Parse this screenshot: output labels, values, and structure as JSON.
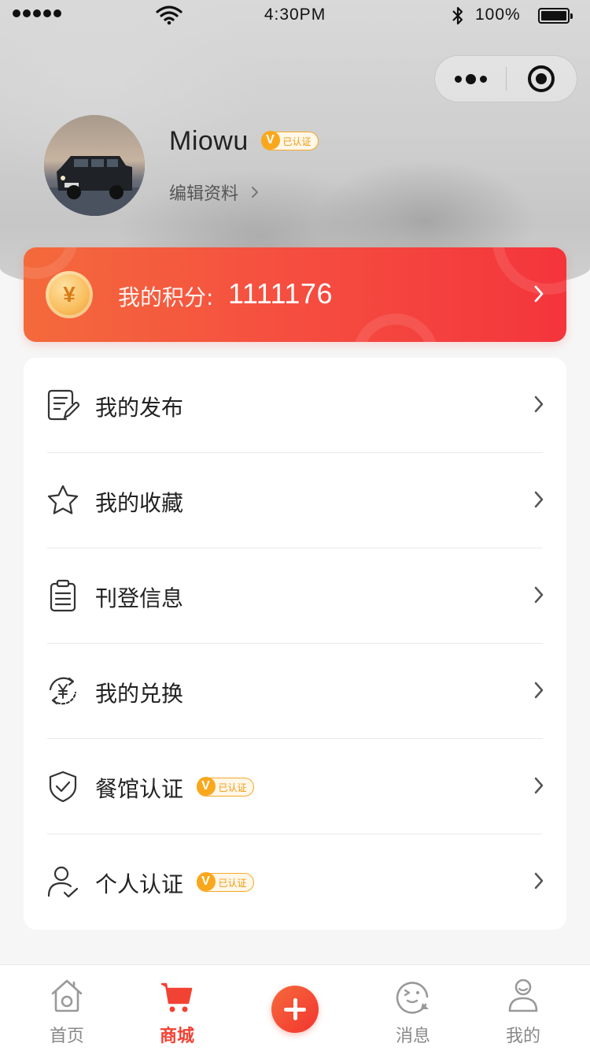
{
  "status_bar": {
    "time": "4:30PM",
    "battery": "100%",
    "icons": [
      "signal-dots-icon",
      "wifi-icon",
      "bluetooth-icon",
      "battery-icon"
    ]
  },
  "capsule": {
    "more_icon": "more-dots-icon",
    "close_icon": "target-close-icon"
  },
  "profile": {
    "name": "Miowu",
    "badge_v": "V",
    "badge_text": "已认证",
    "edit_label": "编辑资料"
  },
  "points": {
    "coin_symbol": "¥",
    "label": "我的积分:",
    "value": "1111176"
  },
  "menu": {
    "items": [
      {
        "label": "我的发布",
        "icon": "edit-document-icon"
      },
      {
        "label": "我的收藏",
        "icon": "star-icon"
      },
      {
        "label": "刊登信息",
        "icon": "clipboard-icon"
      },
      {
        "label": "我的兑换",
        "icon": "exchange-yuan-icon"
      },
      {
        "label": "餐馆认证",
        "icon": "shield-check-icon",
        "badge": "已认证"
      },
      {
        "label": "个人认证",
        "icon": "user-check-icon",
        "badge": "已认证"
      }
    ]
  },
  "tabbar": {
    "tabs": [
      {
        "label": "首页",
        "icon": "home-icon"
      },
      {
        "label": "商城",
        "icon": "cart-icon",
        "active": true
      },
      {
        "label": "",
        "icon": "plus-icon"
      },
      {
        "label": "消息",
        "icon": "message-face-icon"
      },
      {
        "label": "我的",
        "icon": "user-icon"
      }
    ]
  },
  "colors": {
    "accent": "#f24234",
    "badge": "#f9a81d"
  }
}
